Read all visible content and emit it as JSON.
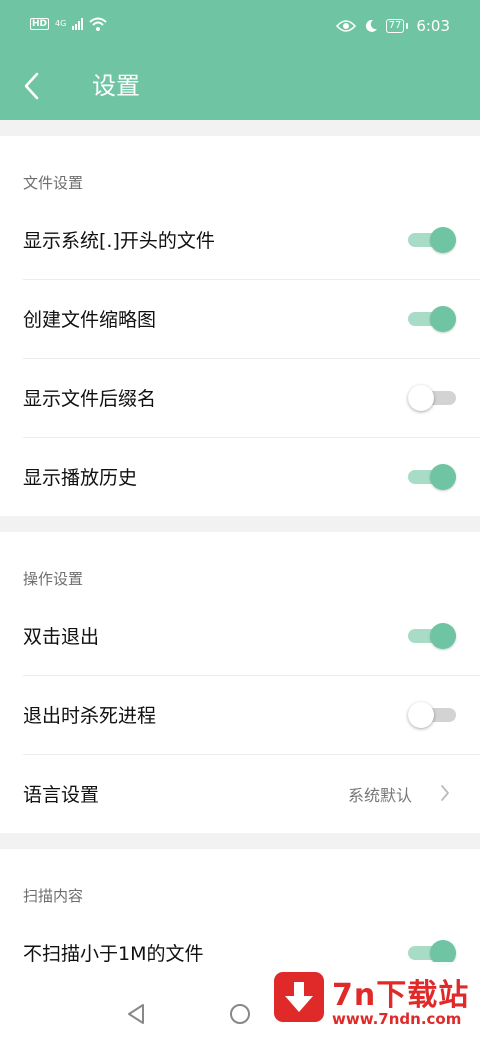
{
  "status_bar": {
    "hd_badge": "HD",
    "network": "4G",
    "battery": "77",
    "time": "6:03"
  },
  "header": {
    "title": "设置"
  },
  "sections": [
    {
      "title": "文件设置",
      "items": [
        {
          "label": "显示系统[.]开头的文件",
          "toggle": true
        },
        {
          "label": "创建文件缩略图",
          "toggle": true
        },
        {
          "label": "显示文件后缀名",
          "toggle": false
        },
        {
          "label": "显示播放历史",
          "toggle": true
        }
      ]
    },
    {
      "title": "操作设置",
      "items": [
        {
          "label": "双击退出",
          "toggle": true
        },
        {
          "label": "退出时杀死进程",
          "toggle": false
        },
        {
          "label": "语言设置",
          "value": "系统默认"
        }
      ]
    },
    {
      "title": "扫描内容",
      "items": [
        {
          "label": "不扫描小于1M的文件",
          "toggle": true
        }
      ]
    }
  ],
  "watermark": {
    "title": "7n下载站",
    "url": "www.7ndn.com"
  },
  "colors": {
    "accent": "#6fc4a4",
    "accent_track": "#a8dcc6",
    "watermark_red": "#e02a2a"
  }
}
